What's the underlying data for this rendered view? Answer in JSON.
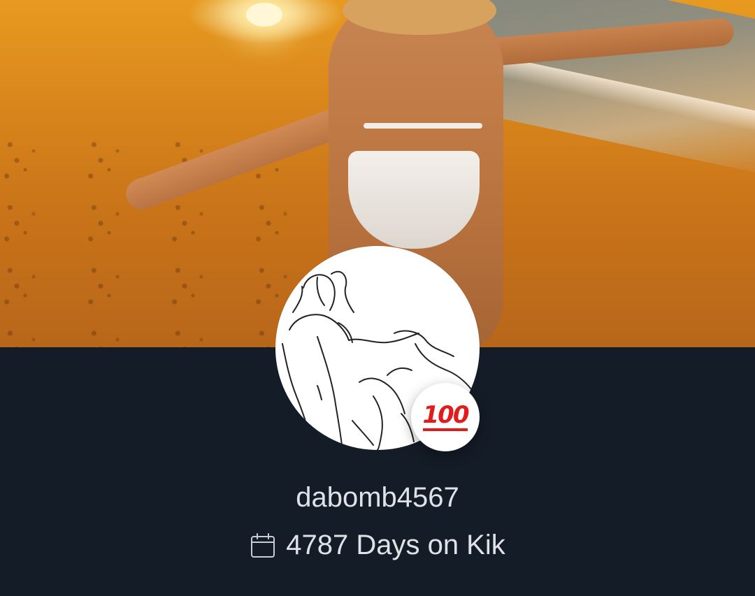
{
  "profile": {
    "username": "dabomb4567",
    "days_on_kik": "4787 Days on Kik",
    "emoji_badge": "💯",
    "emoji_badge_text": "100"
  },
  "icons": {
    "calendar": "calendar-icon",
    "badge": "hundred-points-emoji"
  },
  "colors": {
    "background": "#141c27",
    "text": "#dfe3e8",
    "badge_red": "#e01c1c"
  }
}
